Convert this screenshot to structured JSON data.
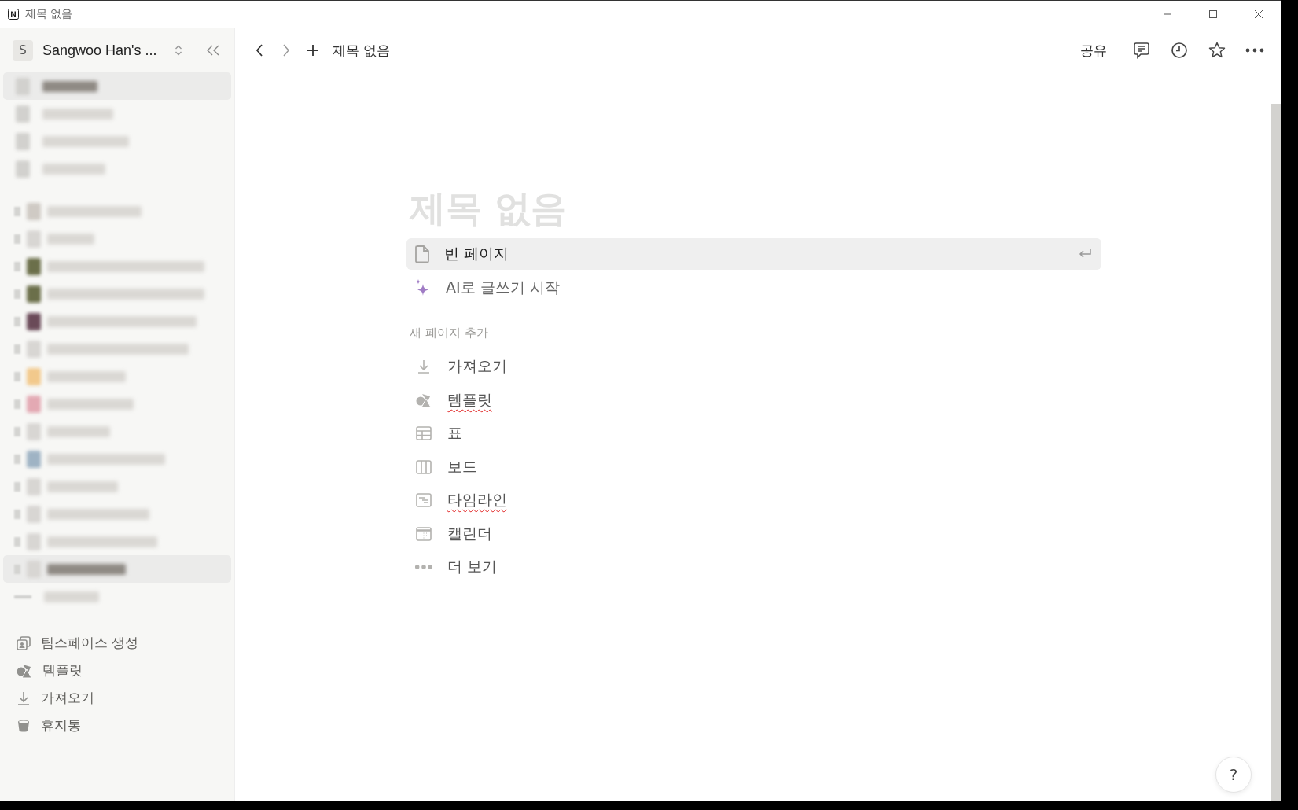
{
  "window": {
    "title": "제목 없음"
  },
  "sidebar": {
    "workspace_initial": "S",
    "workspace_name": "Sangwoo Han's ...",
    "top_items": [
      {
        "kind": "blurred",
        "selected": true
      },
      {
        "kind": "blurred",
        "selected": false
      },
      {
        "kind": "blurred",
        "selected": false
      },
      {
        "kind": "blurred",
        "selected": false
      }
    ],
    "pages": [
      {
        "kind": "blurred",
        "selected": false,
        "color": "#cfcac4"
      },
      {
        "kind": "blurred",
        "selected": false,
        "color": "#d8d6d3"
      },
      {
        "kind": "blurred",
        "selected": false,
        "color": "#6b6f4a"
      },
      {
        "kind": "blurred",
        "selected": false,
        "color": "#6b6f4a"
      },
      {
        "kind": "blurred",
        "selected": false,
        "color": "#6a4a58"
      },
      {
        "kind": "blurred",
        "selected": false,
        "color": "#d8d6d3"
      },
      {
        "kind": "blurred",
        "selected": false,
        "color": "#f2c98c"
      },
      {
        "kind": "blurred",
        "selected": false,
        "color": "#e3a9b3"
      },
      {
        "kind": "blurred",
        "selected": false,
        "color": "#d8d6d3"
      },
      {
        "kind": "blurred",
        "selected": false,
        "color": "#9fb3c4"
      },
      {
        "kind": "blurred",
        "selected": false,
        "color": "#d8d6d3"
      },
      {
        "kind": "blurred",
        "selected": false,
        "color": "#d8d6d3"
      },
      {
        "kind": "blurred",
        "selected": false,
        "color": "#d8d6d3"
      },
      {
        "kind": "blurred",
        "selected": true,
        "color": "#d8d6d3"
      },
      {
        "kind": "blurred-add",
        "selected": false
      }
    ],
    "footer_items": [
      {
        "kind": "teamspace",
        "label": "팀스페이스 생성"
      },
      {
        "kind": "templates",
        "label": "템플릿"
      },
      {
        "kind": "import",
        "label": "가져오기"
      },
      {
        "kind": "trash",
        "label": "휴지통"
      }
    ]
  },
  "topbar": {
    "breadcrumb": "제목 없음",
    "share": "공유"
  },
  "page": {
    "title_placeholder": "제목 없음",
    "options": [
      {
        "kind": "blank",
        "label": "빈 페이지",
        "selected": true
      },
      {
        "kind": "ai",
        "label": "AI로 글쓰기 시작",
        "selected": false
      }
    ],
    "section_label": "새 페이지 추가",
    "add_items": [
      {
        "kind": "import",
        "label": "가져오기",
        "misspelled": false
      },
      {
        "kind": "templates",
        "label": "템플릿",
        "misspelled": true
      },
      {
        "kind": "table",
        "label": "표",
        "misspelled": false
      },
      {
        "kind": "board",
        "label": "보드",
        "misspelled": false
      },
      {
        "kind": "timeline",
        "label": "타임라인",
        "misspelled": true
      },
      {
        "kind": "calendar",
        "label": "캘린더",
        "misspelled": false
      },
      {
        "kind": "more",
        "label": "더 보기",
        "misspelled": false
      }
    ]
  },
  "help": "?"
}
